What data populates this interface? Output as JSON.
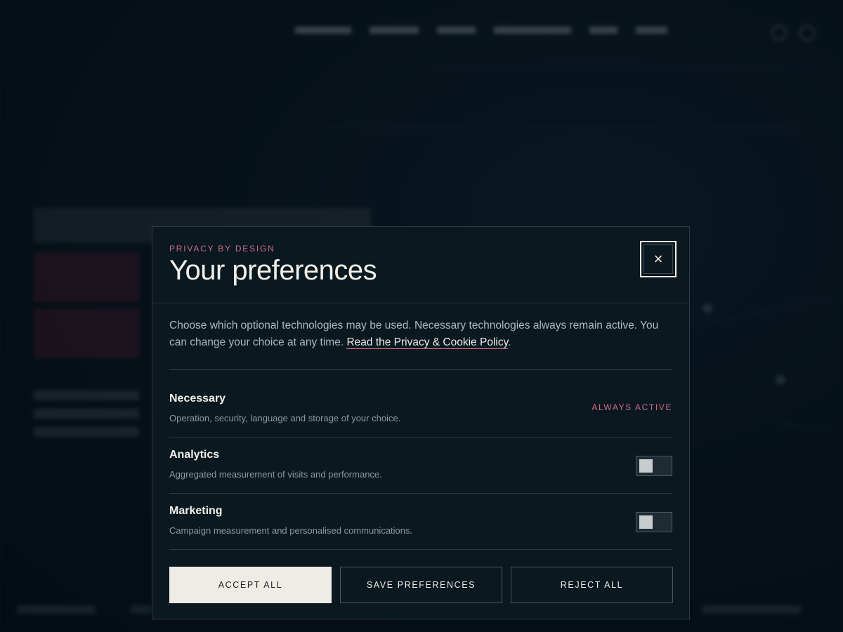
{
  "background": {
    "brand": "",
    "nav": [
      "",
      "",
      "",
      "",
      "",
      ""
    ]
  },
  "modal": {
    "eyebrow": "PRIVACY BY DESIGN",
    "title": "Your preferences",
    "close_label": "×",
    "intro_text": "Choose which optional technologies may be used. Necessary technologies always remain active. You can change your choice at any time. ",
    "policy_link": "Read the Privacy & Cookie Policy",
    "intro_end": ".",
    "preferences": [
      {
        "name": "Necessary",
        "description": "Operation, security, language and storage of your choice.",
        "status": "ALWAYS ACTIVE"
      },
      {
        "name": "Analytics",
        "description": "Aggregated measurement of visits and performance.",
        "enabled": false
      },
      {
        "name": "Marketing",
        "description": "Campaign measurement and personalised communications.",
        "enabled": false
      }
    ],
    "buttons": {
      "accept": "ACCEPT ALL",
      "save": "SAVE PREFERENCES",
      "reject": "REJECT ALL"
    }
  },
  "colors": {
    "accent": "#d26a84",
    "modal_bg": "#0a1820",
    "primary_button": "#efece6"
  },
  "icons": {
    "close": "close-icon"
  }
}
